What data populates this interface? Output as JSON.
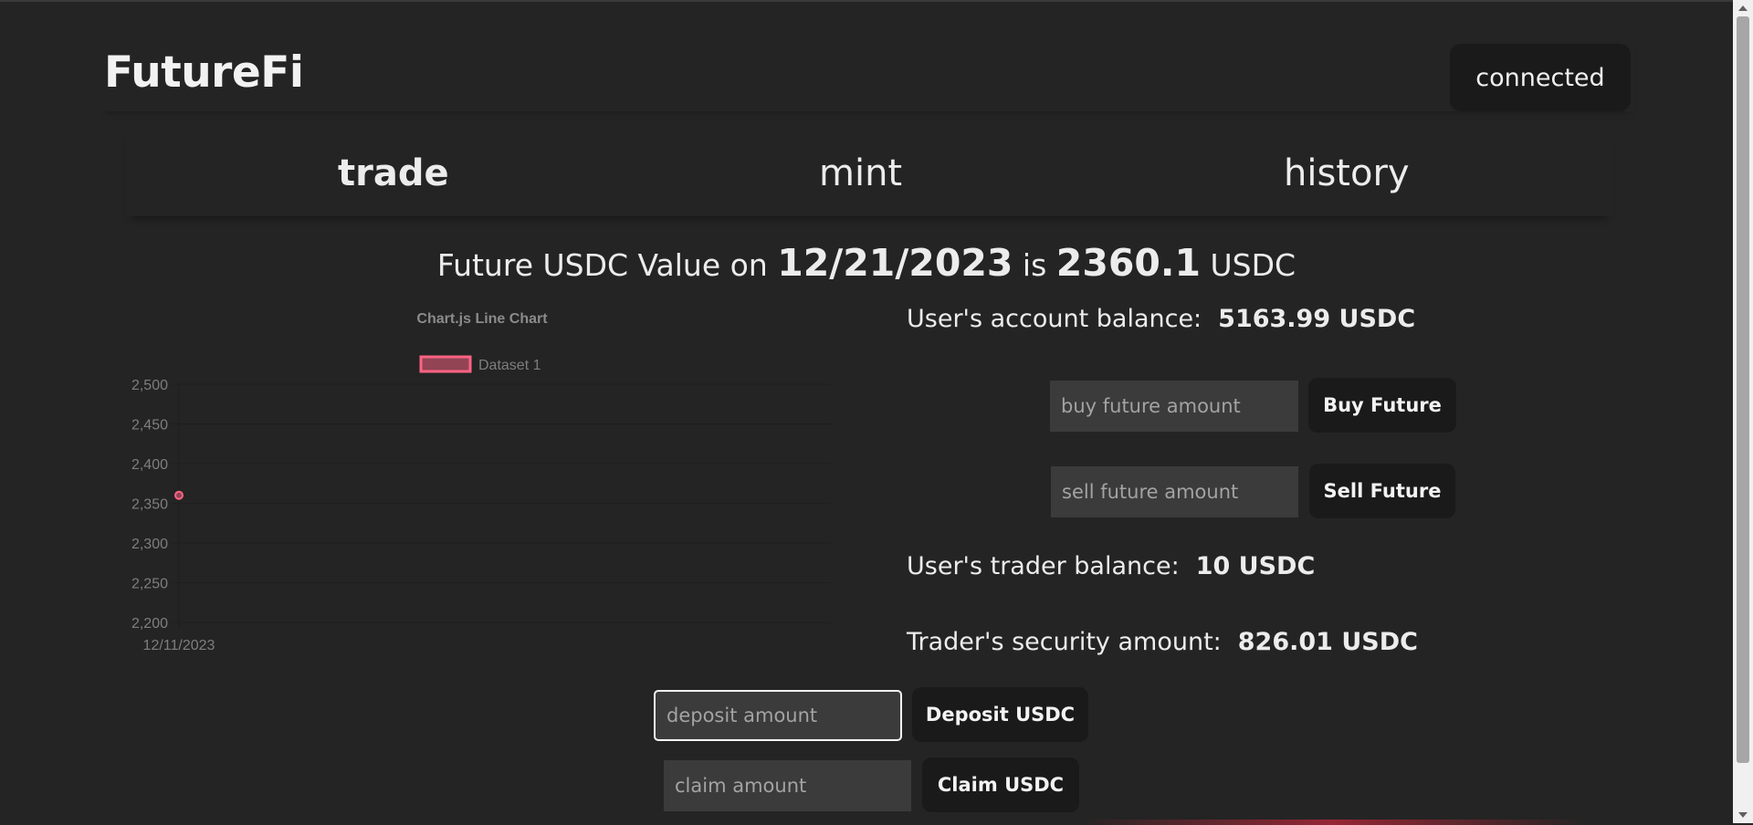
{
  "header": {
    "logo": "FutureFi",
    "connect_label": "connected"
  },
  "tabs": [
    {
      "label": "trade"
    },
    {
      "label": "mint"
    },
    {
      "label": "history"
    }
  ],
  "headline": {
    "prefix": "Future USDC Value on",
    "date": "12/21/2023",
    "mid": "is",
    "value": "2360.1",
    "unit": "USDC"
  },
  "chart_data": {
    "type": "line",
    "title": "Chart.js Line Chart",
    "x": [
      "12/11/2023"
    ],
    "series": [
      {
        "name": "Dataset 1",
        "values": [
          2360.1
        ],
        "color": "#ff6384"
      }
    ],
    "ylim": [
      2200,
      2500
    ],
    "yticks": [
      "2,500",
      "2,450",
      "2,400",
      "2,350",
      "2,300",
      "2,250",
      "2,200"
    ],
    "xticks": [
      "12/11/2023"
    ],
    "grid": true,
    "legend": "top"
  },
  "account": {
    "label": "User's account balance:",
    "value": "5163.99 USDC"
  },
  "buy": {
    "placeholder": "buy future amount",
    "button": "Buy Future"
  },
  "sell": {
    "placeholder": "sell future amount",
    "button": "Sell Future"
  },
  "trader": {
    "label": "User's trader balance:",
    "value": "10 USDC"
  },
  "security": {
    "label": "Trader's security amount:",
    "value": "826.01 USDC"
  },
  "deposit": {
    "placeholder": "deposit amount",
    "button": "Deposit USDC"
  },
  "claim": {
    "placeholder": "claim amount",
    "button": "Claim USDC"
  }
}
